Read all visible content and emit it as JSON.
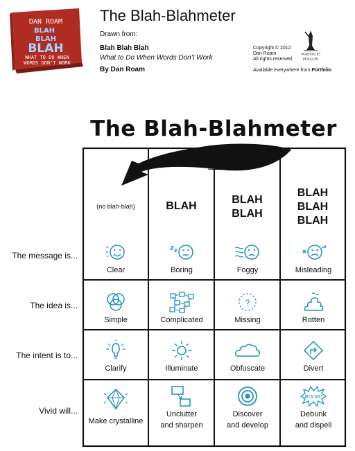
{
  "header": {
    "page_title": "The Blah-Blahmeter",
    "drawn_from": "Drawn from:",
    "book_title": "Blah Blah Blah",
    "book_subtitle": "What to Do When Words Don't Work",
    "author": "By Dan Roam",
    "copyright_lines": [
      "Copyright © 2012",
      "Dan Roam",
      "All rights reserved"
    ],
    "availability_prefix": "Available everywhere from",
    "availability_publisher": "Portfolio",
    "publisher_logo_lines": [
      "PORTFOLIO",
      "PENGUIN"
    ]
  },
  "book_cover": {
    "author_line": "DAN ROAM",
    "title_lines": [
      "BLAH",
      "BLAH",
      "BLAH"
    ],
    "subtitle_lines": [
      "WHAT TO DO WHEN",
      "WORDS DON'T WORK"
    ],
    "color": "#c8372d"
  },
  "meter": {
    "title": "The Blah-Blahmeter",
    "columns": [
      {
        "heading": [
          "(no blah-blah)"
        ]
      },
      {
        "heading": [
          "BLAH"
        ]
      },
      {
        "heading": [
          "BLAH",
          "BLAH"
        ]
      },
      {
        "heading": [
          "BLAH",
          "BLAH",
          "BLAH"
        ]
      }
    ],
    "rows": [
      {
        "label": "The message is...",
        "cells": [
          {
            "text": [
              "Clear"
            ],
            "icon": "smiley-face-icon"
          },
          {
            "text": [
              "Boring"
            ],
            "icon": "sleepy-face-icon"
          },
          {
            "text": [
              "Foggy"
            ],
            "icon": "foggy-face-icon"
          },
          {
            "text": [
              "Misleading"
            ],
            "icon": "confused-face-icon"
          }
        ]
      },
      {
        "label": "The idea is...",
        "cells": [
          {
            "text": [
              "Simple"
            ],
            "icon": "venn-circles-icon"
          },
          {
            "text": [
              "Complicated"
            ],
            "icon": "tangled-boxes-icon"
          },
          {
            "text": [
              "Missing"
            ],
            "icon": "dashed-question-icon"
          },
          {
            "text": [
              "Rotten"
            ],
            "icon": "poop-icon"
          }
        ]
      },
      {
        "label": "The intent is to...",
        "cells": [
          {
            "text": [
              "Clarify"
            ],
            "icon": "lightbulb-icon"
          },
          {
            "text": [
              "Illuminate"
            ],
            "icon": "sun-icon"
          },
          {
            "text": [
              "Obfuscate"
            ],
            "icon": "cloud-icon"
          },
          {
            "text": [
              "Divert"
            ],
            "icon": "turn-sign-icon"
          }
        ]
      },
      {
        "label": "Vivid will...",
        "cells": [
          {
            "text": [
              "Make crystalline"
            ],
            "icon": "crystal-icon"
          },
          {
            "text": [
              "Unclutter",
              "and sharpen"
            ],
            "icon": "boxes-arrow-icon"
          },
          {
            "text": [
              "Discover",
              "and develop"
            ],
            "icon": "target-icon"
          },
          {
            "text": [
              "Debunk",
              "and dispell"
            ],
            "icon": "boom-burst-icon"
          }
        ]
      }
    ],
    "accent_color": "#1e8fc2"
  }
}
